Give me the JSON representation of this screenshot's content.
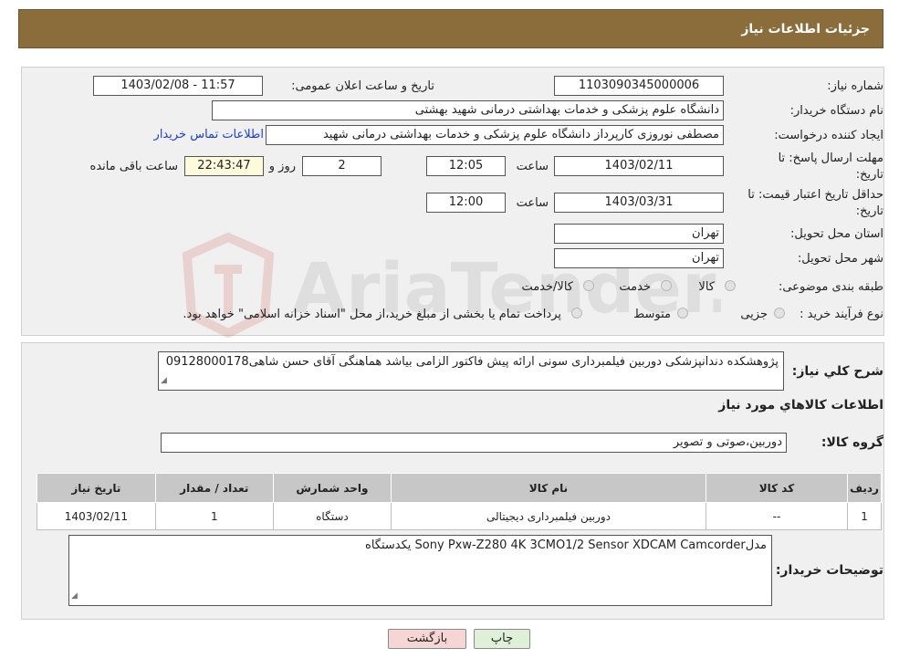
{
  "header": {
    "title": "جزئیات اطلاعات نیاز"
  },
  "details": {
    "need_number_label": "شماره نیاز:",
    "need_number": "1103090345000006",
    "announce_label": "تاریخ و ساعت اعلان عمومی:",
    "announce_value": "1403/02/08 - 11:57",
    "buyer_org_label": "نام دستگاه خریدار:",
    "buyer_org": "دانشگاه علوم پزشکی و خدمات بهداشتی درمانی شهید بهشتی",
    "requester_label": "ایجاد کننده درخواست:",
    "requester": "مصطفی نوروزی کارپرداز دانشگاه علوم پزشکی و خدمات بهداشتی درمانی شهید",
    "contact_link": "اطلاعات تماس خریدار",
    "deadline_label_1": "مهلت ارسال پاسخ: تا",
    "deadline_label_2": "تاریخ:",
    "deadline_date": "1403/02/11",
    "time_label": "ساعت",
    "deadline_time": "12:05",
    "days": "2",
    "days_label": "روز و",
    "remaining_time": "22:43:47",
    "remaining_label": "ساعت باقی مانده",
    "validity_label_1": "حداقل تاریخ اعتبار قیمت: تا",
    "validity_label_2": "تاریخ:",
    "validity_date": "1403/03/31",
    "validity_time": "12:00",
    "province_label": "استان محل تحویل:",
    "province": "تهران",
    "city_label": "شهر محل تحویل:",
    "city": "تهران",
    "category_label": "طبقه بندی موضوعی:",
    "category_options": [
      "کالا",
      "خدمت",
      "کالا/خدمت"
    ],
    "process_label": "نوع فرآیند خرید :",
    "process_options": [
      "جزیی",
      "متوسط"
    ],
    "process_note": "پرداخت تمام یا بخشی از مبلغ خرید،از محل \"اسناد خزانه اسلامی\" خواهد بود."
  },
  "needs": {
    "description_label": "شرح کلي نياز:",
    "description": "پژوهشکده دندانپزشکی دوربین فیلمبرداری سونی ارائه پیش فاکتور الزامی بیاشد هماهنگی آقای حسن شاهی09128000178",
    "items_title": "اطلاعات کالاهاي مورد نياز",
    "group_label": "گروه کالا:",
    "group_value": "دوربین،صوتی و تصویر",
    "table": {
      "headers": [
        "ردیف",
        "کد کالا",
        "نام کالا",
        "واحد شمارش",
        "تعداد / مقدار",
        "تاریخ نیاز"
      ],
      "rows": [
        [
          "1",
          "--",
          "دوربین فیلمبرداری دیجیتالی",
          "دستگاه",
          "1",
          "1403/02/11"
        ]
      ]
    },
    "buyer_notes_label": "توضیحات خریدار:",
    "buyer_notes": "مدلSony Pxw-Z280 4K 3CMO1/2 Sensor XDCAM Camcorder یکدستگاه"
  },
  "buttons": {
    "print": "چاپ",
    "back": "بازگشت"
  },
  "watermark_text": "AriaTender.neT",
  "colors": {
    "header_bg": "#8a6d3b",
    "link": "#1a3fd8",
    "back_button_bg": "#f6d5d5",
    "print_button_bg": "#dff0d8"
  }
}
